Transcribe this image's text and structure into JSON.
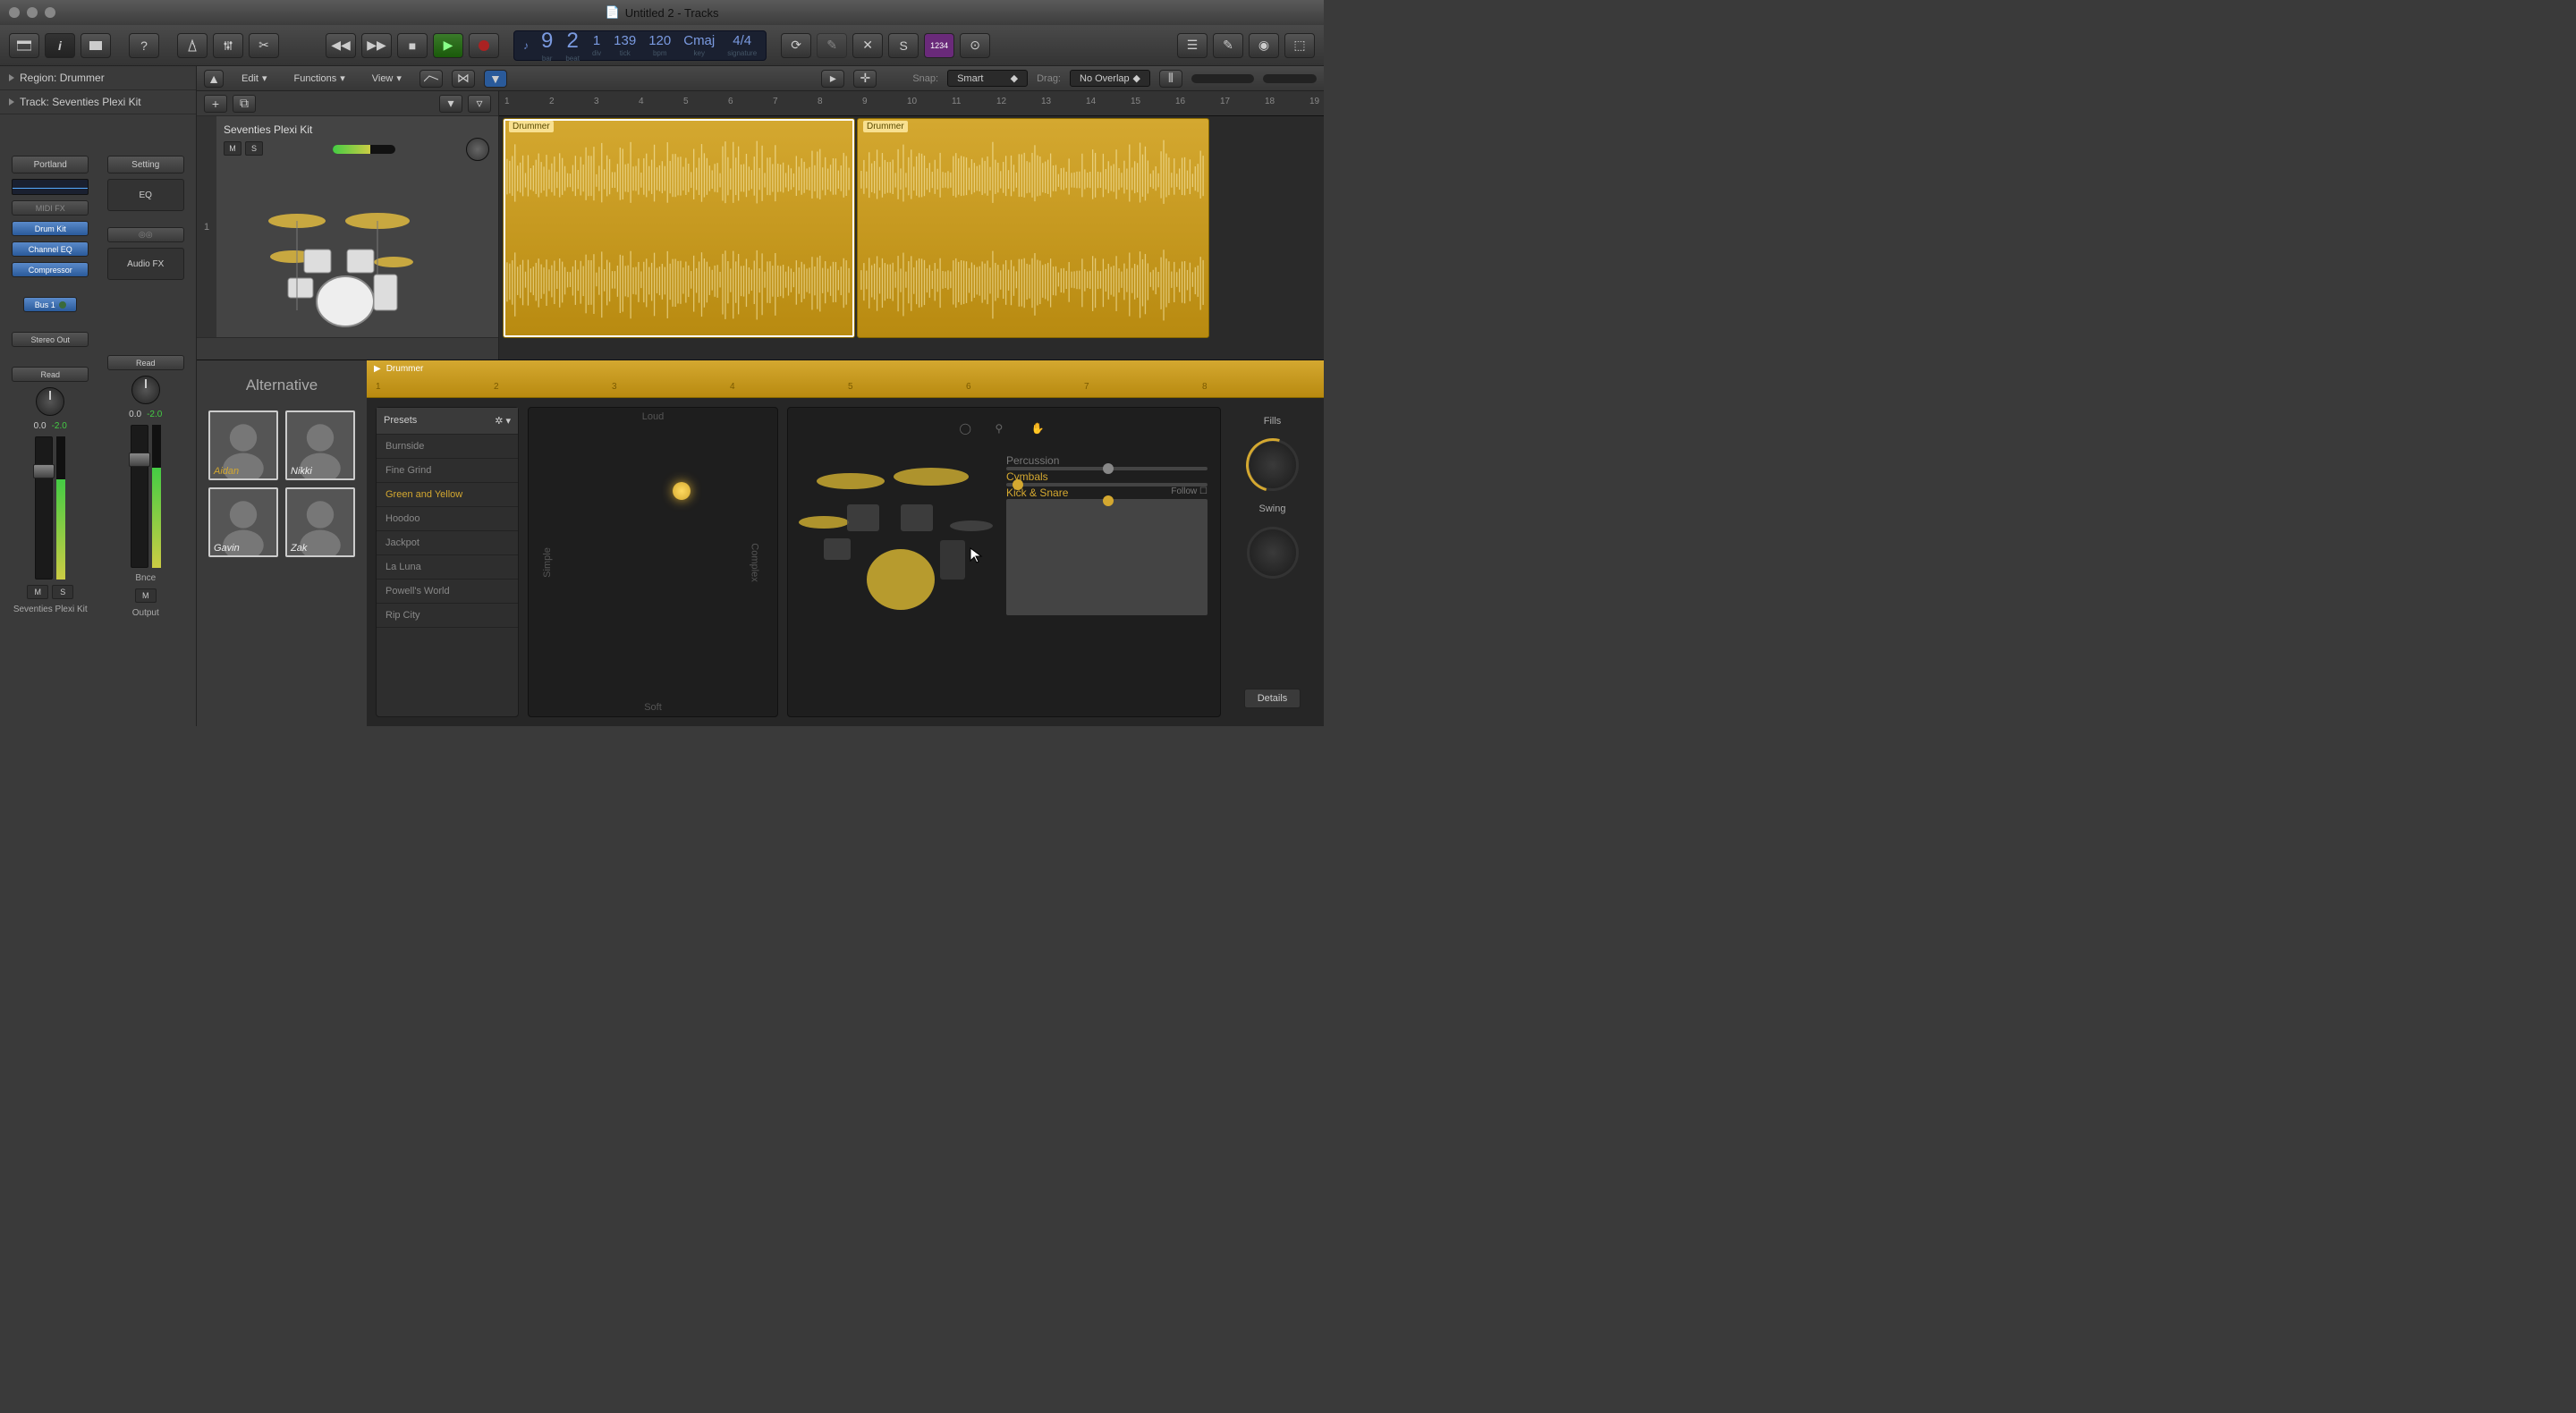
{
  "window": {
    "title": "Untitled 2 - Tracks"
  },
  "lcd": {
    "bar": "9",
    "beat": "2",
    "div": "1",
    "tick": "139",
    "bpm": "120",
    "key": "Cmaj",
    "sig": "4/4",
    "l_bar": "bar",
    "l_beat": "beat",
    "l_div": "div",
    "l_tick": "tick",
    "l_bpm": "bpm",
    "l_key": "key",
    "l_sig": "signature"
  },
  "inspector": {
    "region": "Region: Drummer",
    "track": "Track:  Seventies Plexi Kit",
    "ch1": {
      "preset": "Portland",
      "midifx": "MIDI FX",
      "drumkit": "Drum Kit",
      "cheq": "Channel EQ",
      "comp": "Compressor",
      "bus": "Bus 1",
      "out": "Stereo Out",
      "auto": "Read",
      "pan": "0.0",
      "gain": "-2.0",
      "name": "Seventies Plexi Kit",
      "m": "M",
      "s": "S"
    },
    "ch2": {
      "setting": "Setting",
      "eq": "EQ",
      "afx": "Audio FX",
      "auto": "Read",
      "pan": "0.0",
      "gain": "-2.0",
      "name": "Output",
      "bnce": "Bnce",
      "m": "M"
    }
  },
  "track_menu": {
    "edit": "Edit",
    "functions": "Functions",
    "view": "View",
    "snap_lbl": "Snap:",
    "snap": "Smart",
    "drag_lbl": "Drag:",
    "drag": "No Overlap"
  },
  "track": {
    "name": "Seventies Plexi Kit",
    "num": "1",
    "m": "M",
    "s": "S"
  },
  "ruler": [
    "1",
    "2",
    "3",
    "4",
    "5",
    "6",
    "7",
    "8",
    "9",
    "10",
    "11",
    "12",
    "13",
    "14",
    "15",
    "16",
    "17",
    "18",
    "19"
  ],
  "regions": {
    "r1": "Drummer",
    "r2": "Drummer"
  },
  "editor": {
    "alt": "Alternative",
    "drummers": [
      "Aidan",
      "Nikki",
      "Gavin",
      "Zak"
    ],
    "ruler_lbl": "Drummer",
    "ruler": [
      "1",
      "2",
      "3",
      "4",
      "5",
      "6",
      "7",
      "8"
    ],
    "presets_hdr": "Presets",
    "presets": [
      "Burnside",
      "Fine Grind",
      "Green and Yellow",
      "Hoodoo",
      "Jackpot",
      "La Luna",
      "Powell's World",
      "Rip City"
    ],
    "preset_sel": "Green and Yellow",
    "xy": {
      "top": "Loud",
      "bottom": "Soft",
      "left": "Simple",
      "right": "Complex"
    },
    "inst": {
      "perc": "Percussion",
      "cym": "Cymbals",
      "ks": "Kick & Snare",
      "follow": "Follow"
    },
    "fills": "Fills",
    "swing": "Swing",
    "details": "Details"
  }
}
